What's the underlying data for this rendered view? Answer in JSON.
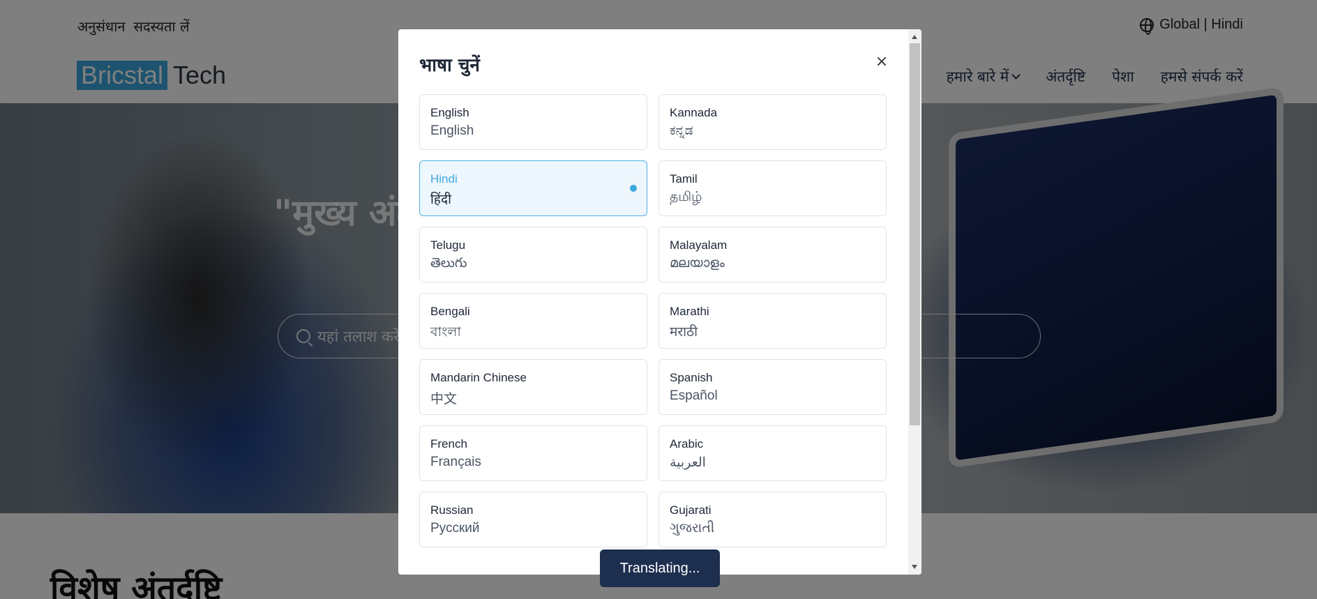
{
  "header": {
    "top_links": [
      "अनुसंधान",
      "सदस्यता लें"
    ],
    "language_switch": "Global | Hindi",
    "logo_box": "Bricstal",
    "logo_text": "Tech",
    "nav": [
      "हमारे बारे में",
      "अंतर्दृष्टि",
      "पेशा",
      "हमसे संपर्क करें"
    ]
  },
  "hero": {
    "headline": "\"मुख्य अंतर्दृष्टि और समाधान खोजने के लिए",
    "search_placeholder": "यहां तलाश करें"
  },
  "section": {
    "title": "विशेष अंतर्दृष्टि"
  },
  "modal": {
    "title": "भाषा चुनें",
    "close_label": "×",
    "languages": [
      {
        "name": "English",
        "native": "English"
      },
      {
        "name": "Kannada",
        "native": "ಕನ್ನಡ"
      },
      {
        "name": "Hindi",
        "native": "हिंदी",
        "selected": true
      },
      {
        "name": "Tamil",
        "native": "தமிழ்"
      },
      {
        "name": "Telugu",
        "native": "తెలుగు"
      },
      {
        "name": "Malayalam",
        "native": "മലയാളം"
      },
      {
        "name": "Bengali",
        "native": "বাংলা"
      },
      {
        "name": "Marathi",
        "native": "मराठी"
      },
      {
        "name": "Mandarin Chinese",
        "native": "中文"
      },
      {
        "name": "Spanish",
        "native": "Español"
      },
      {
        "name": "French",
        "native": "Français"
      },
      {
        "name": "Arabic",
        "native": "العربية"
      },
      {
        "name": "Russian",
        "native": "Русский"
      },
      {
        "name": "Gujarati",
        "native": "ગુજરાતી"
      }
    ]
  },
  "toast": {
    "text": "Translating..."
  },
  "colors": {
    "accent": "#3ba7dc",
    "selected_bg": "#eef7fd",
    "toast_bg": "#1d2e4f"
  }
}
